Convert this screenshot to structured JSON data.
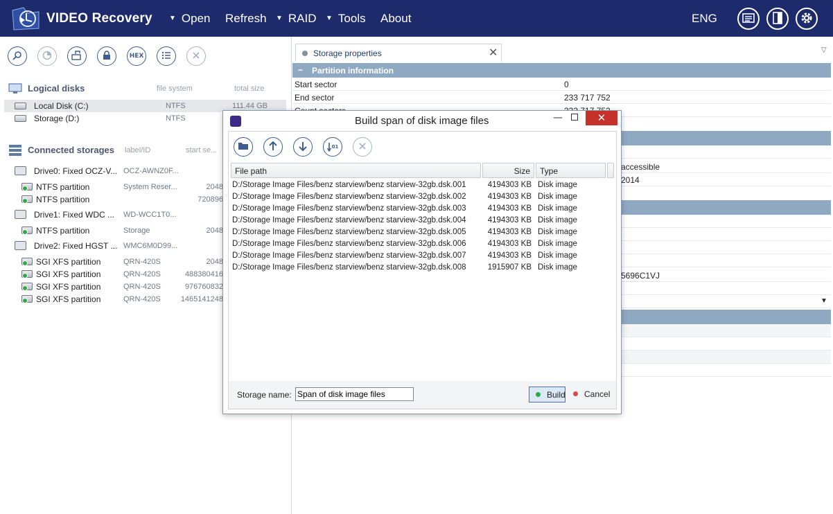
{
  "header": {
    "app_title": "VIDEO Recovery",
    "menu": [
      {
        "label": "Open",
        "dropdown": true
      },
      {
        "label": "Refresh",
        "dropdown": false
      },
      {
        "label": "RAID",
        "dropdown": true
      },
      {
        "label": "Tools",
        "dropdown": true
      },
      {
        "label": "About",
        "dropdown": false
      }
    ],
    "language": "ENG",
    "icons": [
      "log-icon",
      "panel-toggle-icon",
      "settings-gear-icon"
    ]
  },
  "left_panel": {
    "toolbar_icons": [
      "search-icon",
      "scan-icon",
      "open-image-icon",
      "lock-icon",
      "hex-icon",
      "list-icon",
      "close-icon"
    ],
    "hex_label": "HEX",
    "logical_disks": {
      "title": "Logical disks",
      "col_fs": "file system",
      "col_size": "total size",
      "items": [
        {
          "name": "Local Disk (C:)",
          "fs": "NTFS",
          "size": "111.44 GB",
          "selected": true
        },
        {
          "name": "Storage (D:)",
          "fs": "NTFS",
          "size": ""
        }
      ]
    },
    "connected_storages": {
      "title": "Connected storages",
      "col_label": "label/ID",
      "col_start": "start se...",
      "items": [
        {
          "type": "drive",
          "name": "Drive0: Fixed OCZ-V...",
          "label": "OCZ-AWNZ0F...",
          "start": ""
        },
        {
          "type": "partition",
          "name": "NTFS partition",
          "label": "System Reser...",
          "start": "2048"
        },
        {
          "type": "partition",
          "name": "NTFS partition",
          "label": "",
          "start": "720896"
        },
        {
          "type": "drive",
          "name": "Drive1: Fixed WDC ...",
          "label": "WD-WCC1T0...",
          "start": ""
        },
        {
          "type": "partition",
          "name": "NTFS partition",
          "label": "Storage",
          "start": "2048"
        },
        {
          "type": "drive",
          "name": "Drive2: Fixed HGST ...",
          "label": "WMC6M0D99...",
          "start": ""
        },
        {
          "type": "partition",
          "name": "SGI XFS partition",
          "label": "QRN-420S",
          "start": "2048"
        },
        {
          "type": "partition",
          "name": "SGI XFS partition",
          "label": "QRN-420S",
          "start": "488380416"
        },
        {
          "type": "partition",
          "name": "SGI XFS partition",
          "label": "QRN-420S",
          "start": "976760832"
        },
        {
          "type": "partition",
          "name": "SGI XFS partition",
          "label": "QRN-420S",
          "start": "1465141248"
        }
      ]
    }
  },
  "right_panel": {
    "tab_label": "Storage properties",
    "section_title": "Partition information",
    "rows": [
      {
        "key": "Start sector",
        "value": "0"
      },
      {
        "key": "End sector",
        "value": "233 717 752"
      },
      {
        "key": "Count sectors",
        "value": "233 717 752"
      }
    ],
    "partial_values": {
      "accessible": "accessible",
      "year": "2014",
      "serial": "5696C1VJ"
    }
  },
  "dialog": {
    "title": "Build span of disk image files",
    "toolbar_icons": [
      "folder-open-icon",
      "arrow-up-icon",
      "arrow-down-icon",
      "sort-icon",
      "remove-icon"
    ],
    "sort_label": "01",
    "columns": {
      "path": "File path",
      "size": "Size",
      "type": "Type"
    },
    "files": [
      {
        "path": "D:/Storage Image Files/benz starview/benz starview-32gb.dsk.001",
        "size": "4194303 KB",
        "type": "Disk image"
      },
      {
        "path": "D:/Storage Image Files/benz starview/benz starview-32gb.dsk.002",
        "size": "4194303 KB",
        "type": "Disk image"
      },
      {
        "path": "D:/Storage Image Files/benz starview/benz starview-32gb.dsk.003",
        "size": "4194303 KB",
        "type": "Disk image"
      },
      {
        "path": "D:/Storage Image Files/benz starview/benz starview-32gb.dsk.004",
        "size": "4194303 KB",
        "type": "Disk image"
      },
      {
        "path": "D:/Storage Image Files/benz starview/benz starview-32gb.dsk.005",
        "size": "4194303 KB",
        "type": "Disk image"
      },
      {
        "path": "D:/Storage Image Files/benz starview/benz starview-32gb.dsk.006",
        "size": "4194303 KB",
        "type": "Disk image"
      },
      {
        "path": "D:/Storage Image Files/benz starview/benz starview-32gb.dsk.007",
        "size": "4194303 KB",
        "type": "Disk image"
      },
      {
        "path": "D:/Storage Image Files/benz starview/benz starview-32gb.dsk.008",
        "size": "1915907 KB",
        "type": "Disk image"
      }
    ],
    "storage_name_label": "Storage name:",
    "storage_name_value": "Span of disk image files",
    "build_label": "Build",
    "cancel_label": "Cancel"
  },
  "colors": {
    "topbar": "#1d2a6b",
    "section_band": "#8fa9c2",
    "close_red": "#c7312b",
    "status_green": "#2fa84a",
    "accent_blue": "#3e5c8e"
  }
}
